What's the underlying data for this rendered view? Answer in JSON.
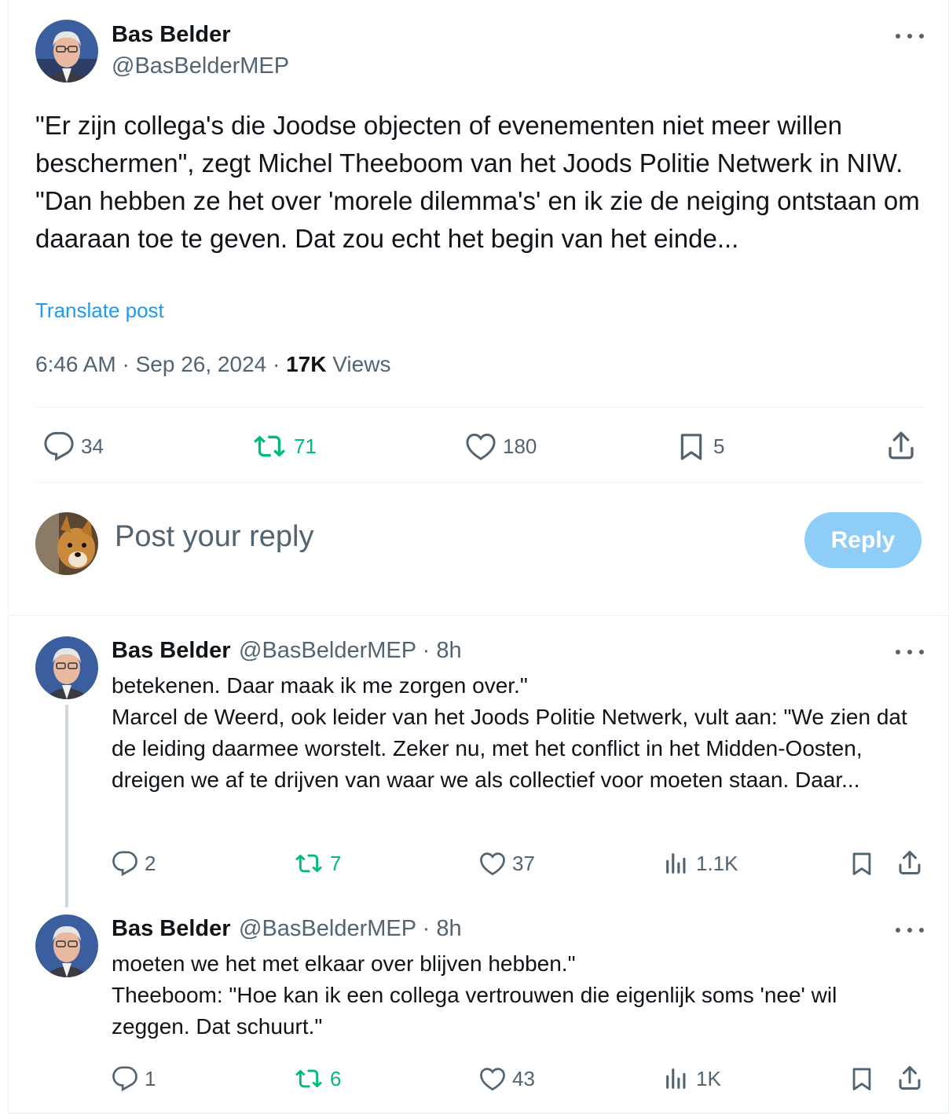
{
  "main_post": {
    "author_name": "Bas Belder",
    "author_handle": "@BasBelderMEP",
    "text": "\"Er zijn collega's die Joodse objecten of evenementen niet meer willen beschermen\", zegt Michel Theeboom van het Joods Politie Netwerk in NIW. \"Dan hebben ze het over 'morele dilemma's' en ik zie de neiging ontstaan om daaraan toe te geven. Dat zou echt het begin van het einde...",
    "translate_label": "Translate post",
    "time": "6:46 AM",
    "date": "Sep 26, 2024",
    "views_count": "17K",
    "views_label": "Views",
    "replies": "34",
    "reposts": "71",
    "likes": "180",
    "bookmarks": "5"
  },
  "composer": {
    "placeholder": "Post your reply",
    "reply_button": "Reply"
  },
  "replies": [
    {
      "author_name": "Bas Belder",
      "author_handle": "@BasBelderMEP",
      "time_ago": "8h",
      "text": "betekenen. Daar maak ik me zorgen over.\"\nMarcel de Weerd, ook leider van het Joods Politie Netwerk, vult aan: \"We zien dat de leiding daarmee worstelt. Zeker nu, met het conflict in het Midden-Oosten, dreigen we af te drijven van waar we als collectief voor moeten staan. Daar...",
      "replies": "2",
      "reposts": "7",
      "likes": "37",
      "views": "1.1K"
    },
    {
      "author_name": "Bas Belder",
      "author_handle": "@BasBelderMEP",
      "time_ago": "8h",
      "text": "moeten we het met elkaar over blijven hebben.\"\nTheeboom: \"Hoe kan ik een collega vertrouwen die eigenlijk soms 'nee' wil zeggen. Dat schuurt.\"",
      "replies": "1",
      "reposts": "6",
      "likes": "43",
      "views": "1K"
    }
  ],
  "colors": {
    "text_primary": "#0f1419",
    "text_secondary": "#536471",
    "link": "#1d9bf0",
    "repost_green": "#00ba7c",
    "reply_button_disabled": "#8ecdf8",
    "divider": "#eff3f4"
  },
  "icons": {
    "reply": "speech-bubble-icon",
    "repost": "repost-arrows-icon",
    "like": "heart-icon",
    "bookmark": "bookmark-icon",
    "share": "share-upload-icon",
    "views": "bar-chart-icon",
    "more": "more-dots-icon"
  }
}
